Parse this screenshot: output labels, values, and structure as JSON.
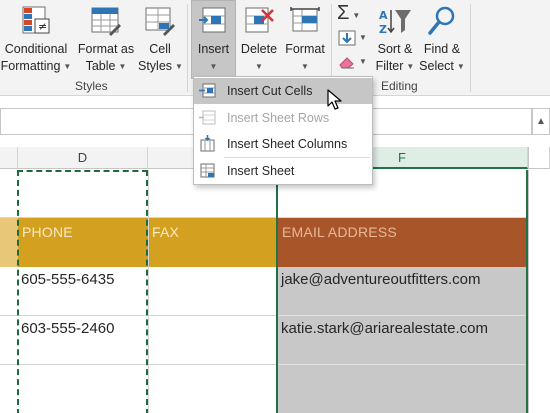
{
  "ribbon": {
    "styles_group": {
      "label": "Styles",
      "conditional_formatting": {
        "line1": "Conditional",
        "line2": "Formatting"
      },
      "format_as_table": {
        "line1": "Format as",
        "line2": "Table"
      },
      "cell_styles": {
        "line1": "Cell",
        "line2": "Styles"
      }
    },
    "cells_group": {
      "insert": {
        "line1": "Insert"
      },
      "delete": {
        "line1": "Delete"
      },
      "format": {
        "line1": "Format"
      }
    },
    "editing_group": {
      "label": "Editing",
      "sort_filter": {
        "line1": "Sort &",
        "line2": "Filter"
      },
      "find_select": {
        "line1": "Find &",
        "line2": "Select"
      }
    }
  },
  "insert_menu": {
    "items": [
      {
        "label": "Insert Cut Cells",
        "icon": "insert-cut-cells-icon",
        "state": "hover"
      },
      {
        "label": "Insert Sheet Rows",
        "icon": "insert-sheet-rows-icon",
        "state": "disabled"
      },
      {
        "label": "Insert Sheet Columns",
        "icon": "insert-sheet-columns-icon",
        "state": "normal"
      },
      {
        "label": "Insert Sheet",
        "icon": "insert-sheet-icon",
        "state": "normal"
      }
    ]
  },
  "sheet": {
    "columns": [
      {
        "letter": "D",
        "selected": false
      },
      {
        "letter": "F",
        "selected": true
      }
    ],
    "header_row": {
      "phone": "PHONE",
      "fax": "FAX",
      "email": "EMAIL ADDRESS"
    },
    "rows": [
      {
        "phone": "605-555-6435",
        "email": "jake@adventureoutfitters.com"
      },
      {
        "phone": "603-555-2460",
        "email": "katie.stark@ariarealestate.com"
      }
    ]
  },
  "colors": {
    "header_gold": "#d4a020",
    "header_rust": "#a9552a",
    "selection_gray": "#c8c8c8",
    "excel_green": "#217346",
    "cut_border": "#1e6b3a"
  }
}
